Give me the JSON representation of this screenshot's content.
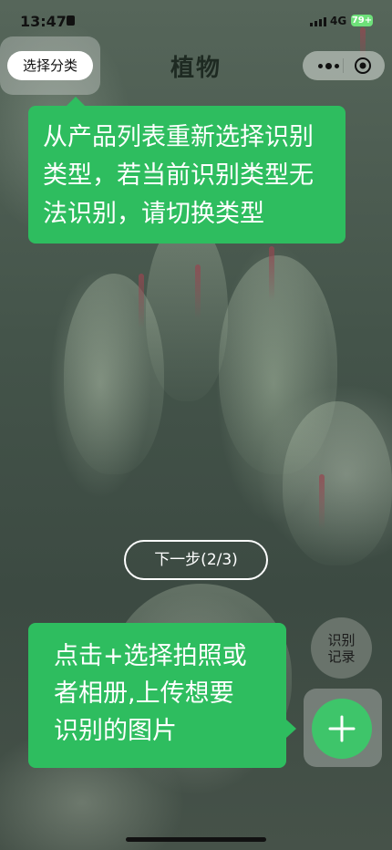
{
  "status_bar": {
    "time": "13:47",
    "network": "4G",
    "battery": "79+"
  },
  "nav": {
    "title": "植物",
    "category_button": "选择分类"
  },
  "tooltips": {
    "top_lines": [
      "从产品列表重新选择识别",
      "类型，若当前识别类型无",
      "法识别，请切换类型"
    ],
    "bottom_lines": [
      "点击+选择拍照或",
      "者相册,上传想要",
      "识别的图片"
    ]
  },
  "guide": {
    "next_button": "下一步(2/3)"
  },
  "history_button": {
    "line1": "识别",
    "line2": "记录"
  },
  "colors": {
    "accent_green": "#2ebd5f",
    "add_button": "#3ec56a"
  }
}
